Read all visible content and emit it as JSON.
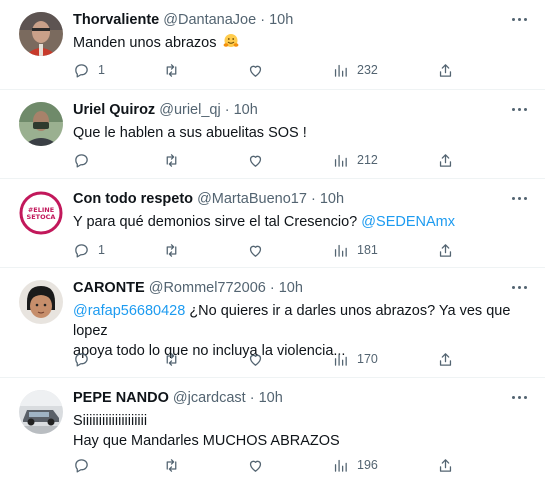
{
  "tweets": [
    {
      "name": "Thorvaliente",
      "handle": "@DantanaJoe",
      "time": "10h",
      "text": "Manden unos abrazos",
      "emoji": "hugging-face",
      "replies": "1",
      "retweets": "",
      "likes": "",
      "views": "232"
    },
    {
      "name": "Uriel Quiroz",
      "handle": "@uriel_qj",
      "time": "10h",
      "text": "Que le hablen a sus abuelitas SOS !",
      "replies": "",
      "retweets": "",
      "likes": "",
      "views": "212"
    },
    {
      "name": "Con todo respeto",
      "handle": "@MartaBueno17",
      "time": "10h",
      "text": "Y para qué demonios sirve el tal Cresencio?",
      "mention": "@SEDENAmx",
      "avatar_text": "#ELINENOSETOCA",
      "replies": "1",
      "retweets": "",
      "likes": "",
      "views": "181"
    },
    {
      "name": "CARONTE",
      "handle": "@Rommel772006",
      "time": "10h",
      "mention": "@rafap56680428",
      "text_line1": " ¿No quieres ir a darles unos abrazos? Ya ves que lopez",
      "text_line2": "apoya todo lo que no incluya la violencia...",
      "replies": "",
      "retweets": "",
      "likes": "",
      "views": "170"
    },
    {
      "name": "PEPE NANDO",
      "handle": "@jcardcast",
      "time": "10h",
      "text_line1": "Siiiiiiiiiiiiiiiiiiii",
      "text_line2": "Hay que Mandarles MUCHOS ABRAZOS",
      "replies": "",
      "retweets": "",
      "likes": "",
      "views": "196"
    }
  ],
  "colors": {
    "text": "#0f1419",
    "secondary": "#536471",
    "link": "#1d9bf0",
    "divider": "#eff3f4"
  },
  "icons": [
    "more-icon",
    "reply-icon",
    "retweet-icon",
    "like-icon",
    "views-icon",
    "share-icon"
  ]
}
